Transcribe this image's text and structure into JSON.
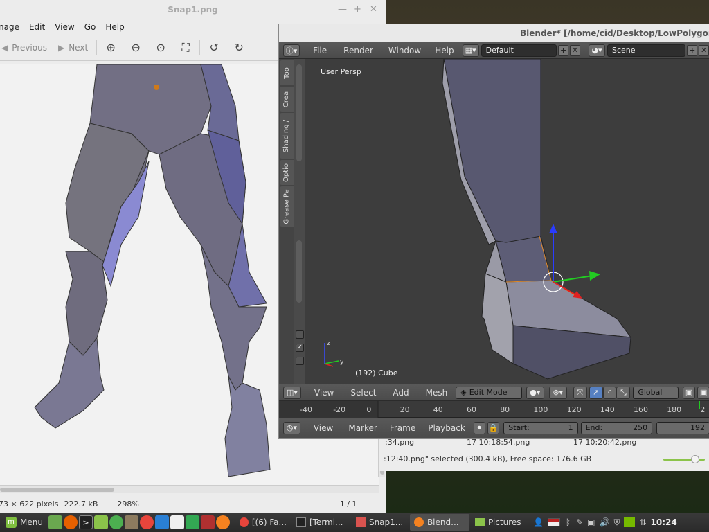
{
  "viewer": {
    "title": "Snap1.png",
    "menu": [
      "nage",
      "Edit",
      "View",
      "Go",
      "Help"
    ],
    "toolbar": {
      "previous": "Previous",
      "next": "Next"
    },
    "status": {
      "dimensions": "73 × 622 pixels",
      "size": "222.7 kB",
      "zoom": "298%",
      "position": "1 / 1"
    }
  },
  "files": {
    "row": [
      ":34.png",
      "17 10:18:54.png",
      "17 10:20:42.png"
    ],
    "status": ":12:40.png\" selected (300.4 kB), Free space: 176.6 GB"
  },
  "blender": {
    "title": "Blender* [/home/cid/Desktop/LowPolygonMa",
    "menu": [
      "File",
      "Render",
      "Window",
      "Help"
    ],
    "layout": "Default",
    "scene": "Scene",
    "tabs": [
      "Too",
      "Crea",
      "Shading /",
      "Optio",
      "Grease Pe"
    ],
    "viewport": {
      "label": "User Persp",
      "object": "(192) Cube"
    },
    "view3d_header": {
      "menu": [
        "View",
        "Select",
        "Add",
        "Mesh"
      ],
      "mode": "Edit Mode",
      "orientation": "Global"
    },
    "timeline": {
      "ticks": [
        "-40",
        "-20",
        "0",
        "20",
        "40",
        "60",
        "80",
        "100",
        "120",
        "140",
        "160",
        "180",
        "2"
      ],
      "menu": [
        "View",
        "Marker",
        "Frame",
        "Playback"
      ],
      "start_label": "Start:",
      "start": "1",
      "end_label": "End:",
      "end": "250",
      "current": "192"
    }
  },
  "taskbar": {
    "menu": "Menu",
    "tasks": [
      "[(6) Fa...",
      "[Termi...",
      "Snap1...",
      "Blend...",
      "Pictures"
    ],
    "clock": "10:24"
  }
}
